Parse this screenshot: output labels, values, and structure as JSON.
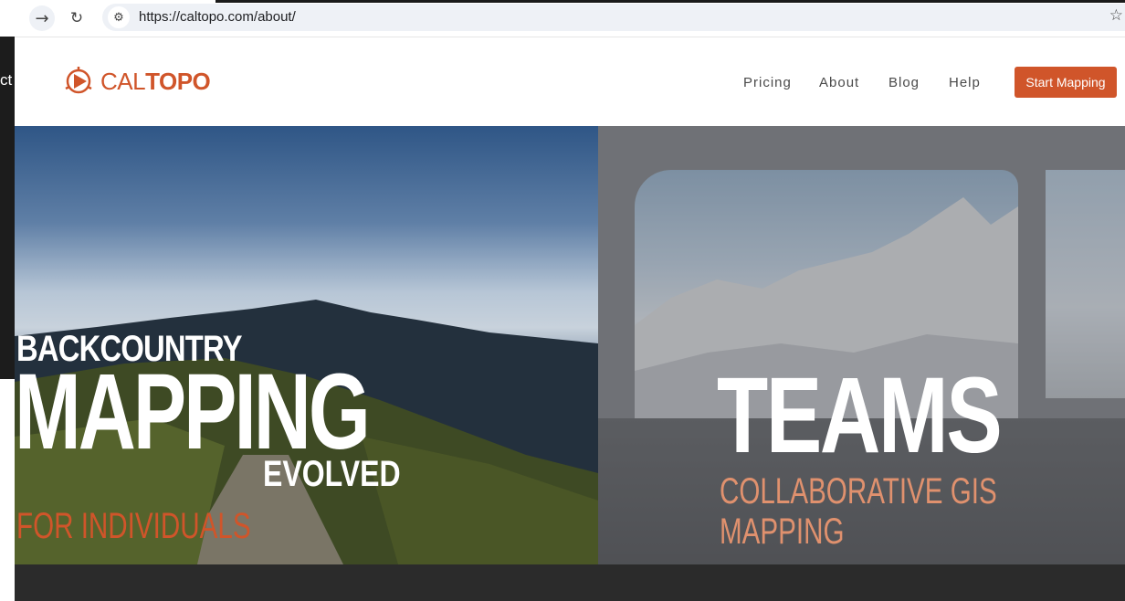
{
  "browser": {
    "url": "https://caltopo.com/about/"
  },
  "side_fragment": "ct",
  "site": {
    "logo_text_light": "CAL",
    "logo_text_bold": "TOPO",
    "nav": {
      "pricing": "Pricing",
      "about": "About",
      "blog": "Blog",
      "help": "Help"
    },
    "cta_label": "Start Mapping",
    "brand_color": "#d0552a"
  },
  "hero_left": {
    "line1": "BACKCOUNTRY",
    "line2": "MAPPING",
    "line3": "EVOLVED",
    "subtitle": "FOR INDIVIDUALS"
  },
  "hero_right": {
    "title": "TEAMS",
    "subtitle_line1": "COLLABORATIVE GIS",
    "subtitle_line2": "MAPPING"
  }
}
